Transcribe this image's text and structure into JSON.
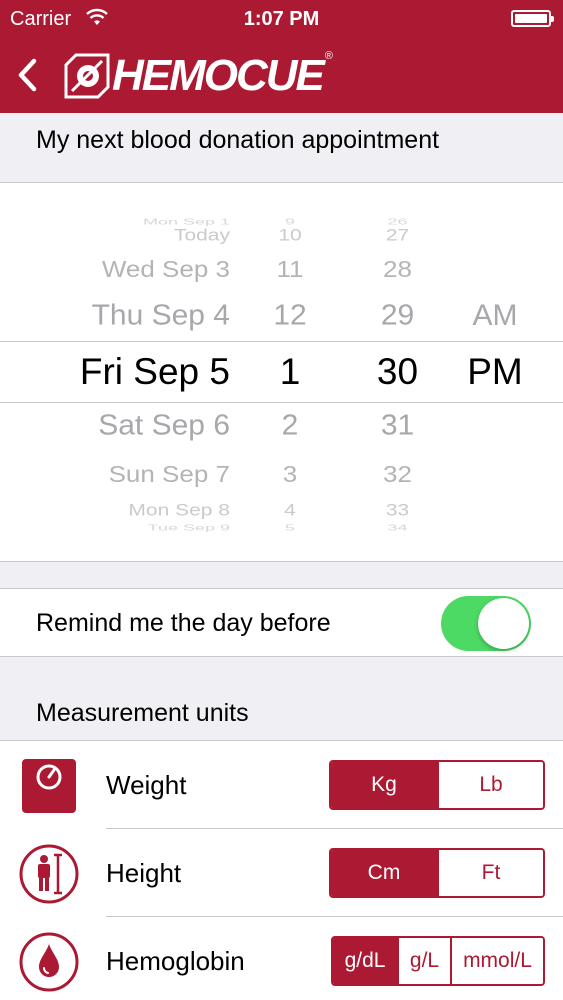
{
  "status_bar": {
    "carrier": "Carrier",
    "time": "1:07 PM"
  },
  "header": {
    "logo_text": "HEMOCUE",
    "logo_registered": "®"
  },
  "appointment": {
    "section_title": "My next blood donation appointment",
    "picker": {
      "dates": [
        "Mon Sep 1",
        "Today",
        "Wed Sep 3",
        "Thu Sep 4",
        "Fri Sep 5",
        "Sat Sep 6",
        "Sun Sep 7",
        "Mon Sep 8",
        "Tue Sep 9"
      ],
      "hours": [
        "9",
        "10",
        "11",
        "12",
        "1",
        "2",
        "3",
        "4",
        "5"
      ],
      "minutes": [
        "26",
        "27",
        "28",
        "29",
        "30",
        "31",
        "32",
        "33",
        "34"
      ],
      "ampm": [
        "AM",
        "PM"
      ],
      "selected": {
        "date": "Fri Sep 5",
        "hour": "1",
        "minute": "30",
        "ampm": "PM"
      }
    }
  },
  "reminder": {
    "label": "Remind me the day before",
    "enabled": true
  },
  "measurement": {
    "section_title": "Measurement units",
    "rows": [
      {
        "label": "Weight",
        "icon": "scale-icon",
        "options": [
          "Kg",
          "Lb"
        ],
        "selected": "Kg"
      },
      {
        "label": "Height",
        "icon": "person-height-icon",
        "options": [
          "Cm",
          "Ft"
        ],
        "selected": "Cm"
      },
      {
        "label": "Hemoglobin",
        "icon": "blood-drop-icon",
        "options": [
          "g/dL",
          "g/L",
          "mmol/L"
        ],
        "selected": "g/dL"
      }
    ]
  },
  "colors": {
    "brand": "#ab1a32",
    "toggle_on": "#4cd964",
    "background": "#efeff4"
  }
}
